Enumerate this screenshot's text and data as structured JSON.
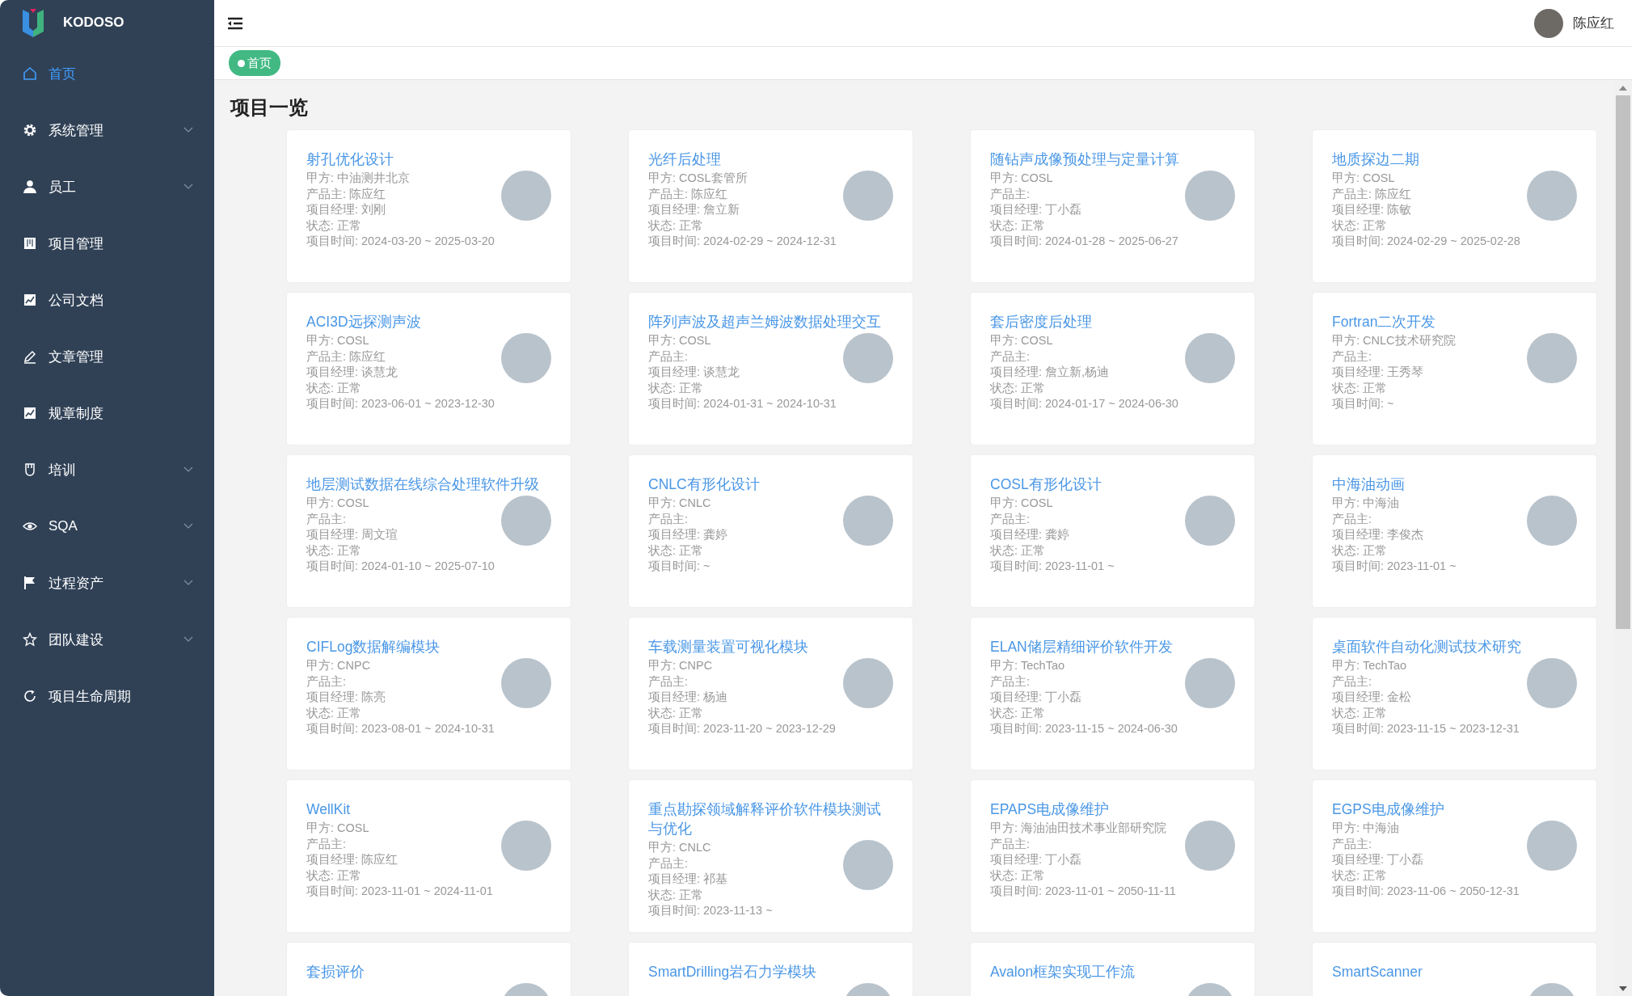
{
  "brand": {
    "name": "KODOSO"
  },
  "sidebar": {
    "items": [
      {
        "label": "首页",
        "selected": true,
        "has_submenu": false
      },
      {
        "label": "系统管理",
        "selected": false,
        "has_submenu": true
      },
      {
        "label": "员工",
        "selected": false,
        "has_submenu": true
      },
      {
        "label": "项目管理",
        "selected": false,
        "has_submenu": false
      },
      {
        "label": "公司文档",
        "selected": false,
        "has_submenu": false
      },
      {
        "label": "文章管理",
        "selected": false,
        "has_submenu": false
      },
      {
        "label": "规章制度",
        "selected": false,
        "has_submenu": false
      },
      {
        "label": "培训",
        "selected": false,
        "has_submenu": true
      },
      {
        "label": "SQA",
        "selected": false,
        "has_submenu": true
      },
      {
        "label": "过程资产",
        "selected": false,
        "has_submenu": true
      },
      {
        "label": "团队建设",
        "selected": false,
        "has_submenu": true
      },
      {
        "label": "项目生命周期",
        "selected": false,
        "has_submenu": false
      }
    ]
  },
  "header": {
    "user_name": "陈应红"
  },
  "tags": [
    {
      "label": "首页",
      "selected": true
    }
  ],
  "page_title": "项目一览",
  "projects": [
    {
      "title": "射孔优化设计",
      "lines": [
        "甲方: 中油测井北京",
        "产品主: 陈应红",
        "项目经理: 刘刚",
        "状态: 正常",
        "项目时间: 2024-03-20 ~ 2025-03-20"
      ]
    },
    {
      "title": "光纤后处理",
      "lines": [
        "甲方: COSL套管所",
        "产品主: 陈应红",
        "项目经理: 詹立新",
        "状态: 正常",
        "项目时间: 2024-02-29 ~ 2024-12-31"
      ]
    },
    {
      "title": "随钻声成像预处理与定量计算",
      "lines": [
        "甲方: COSL",
        "产品主:",
        "项目经理: 丁小磊",
        "状态: 正常",
        "项目时间: 2024-01-28 ~ 2025-06-27"
      ]
    },
    {
      "title": "地质探边二期",
      "lines": [
        "甲方: COSL",
        "产品主: 陈应红",
        "项目经理: 陈敏",
        "状态: 正常",
        "项目时间: 2024-02-29 ~ 2025-02-28"
      ]
    },
    {
      "title": "ACI3D远探测声波",
      "lines": [
        "甲方: COSL",
        "产品主: 陈应红",
        "项目经理: 谈慧龙",
        "状态: 正常",
        "项目时间: 2023-06-01 ~ 2023-12-30"
      ]
    },
    {
      "title": "阵列声波及超声兰姆波数据处理交互",
      "lines": [
        "甲方: COSL",
        "产品主:",
        "项目经理: 谈慧龙",
        "状态: 正常",
        "项目时间: 2024-01-31 ~ 2024-10-31"
      ]
    },
    {
      "title": "套后密度后处理",
      "lines": [
        "甲方: COSL",
        "产品主:",
        "项目经理: 詹立新,杨迪",
        "状态: 正常",
        "项目时间: 2024-01-17 ~ 2024-06-30"
      ]
    },
    {
      "title": "Fortran二次开发",
      "lines": [
        "甲方: CNLC技术研究院",
        "产品主:",
        "项目经理: 王秀琴",
        "状态: 正常",
        "项目时间: ~"
      ]
    },
    {
      "title": "地层测试数据在线综合处理软件升级",
      "lines": [
        "甲方: COSL",
        "产品主:",
        "项目经理: 周文瑄",
        "状态: 正常",
        "项目时间: 2024-01-10 ~ 2025-07-10"
      ]
    },
    {
      "title": "CNLC有形化设计",
      "lines": [
        "甲方: CNLC",
        "产品主:",
        "项目经理: 龚婷",
        "状态: 正常",
        "项目时间: ~"
      ]
    },
    {
      "title": "COSL有形化设计",
      "lines": [
        "甲方: COSL",
        "产品主:",
        "项目经理: 龚婷",
        "状态: 正常",
        "项目时间: 2023-11-01 ~"
      ]
    },
    {
      "title": "中海油动画",
      "lines": [
        "甲方: 中海油",
        "产品主:",
        "项目经理: 李俊杰",
        "状态: 正常",
        "项目时间: 2023-11-01 ~"
      ]
    },
    {
      "title": "CIFLog数据解编模块",
      "lines": [
        "甲方: CNPC",
        "产品主:",
        "项目经理: 陈亮",
        "状态: 正常",
        "项目时间: 2023-08-01 ~ 2024-10-31"
      ]
    },
    {
      "title": "车载测量装置可视化模块",
      "lines": [
        "甲方: CNPC",
        "产品主:",
        "项目经理: 杨迪",
        "状态: 正常",
        "项目时间: 2023-11-20 ~ 2023-12-29"
      ]
    },
    {
      "title": "ELAN储层精细评价软件开发",
      "lines": [
        "甲方: TechTao",
        "产品主:",
        "项目经理: 丁小磊",
        "状态: 正常",
        "项目时间: 2023-11-15 ~ 2024-06-30"
      ]
    },
    {
      "title": "桌面软件自动化测试技术研究",
      "lines": [
        "甲方: TechTao",
        "产品主:",
        "项目经理: 金松",
        "状态: 正常",
        "项目时间: 2023-11-15 ~ 2023-12-31"
      ]
    },
    {
      "title": "WellKit",
      "lines": [
        "甲方: COSL",
        "产品主:",
        "项目经理: 陈应红",
        "状态: 正常",
        "项目时间: 2023-11-01 ~ 2024-11-01"
      ]
    },
    {
      "title": "重点勘探领域解释评价软件模块测试与优化",
      "lines": [
        "甲方: CNLC",
        "产品主:",
        "项目经理: 祁基",
        "状态: 正常",
        "项目时间: 2023-11-13 ~"
      ]
    },
    {
      "title": "EPAPS电成像维护",
      "lines": [
        "甲方: 海油油田技术事业部研究院",
        "产品主:",
        "项目经理: 丁小磊",
        "状态: 正常",
        "项目时间: 2023-11-01 ~ 2050-11-11"
      ]
    },
    {
      "title": "EGPS电成像维护",
      "lines": [
        "甲方: 中海油",
        "产品主:",
        "项目经理: 丁小磊",
        "状态: 正常",
        "项目时间: 2023-11-06 ~ 2050-12-31"
      ]
    },
    {
      "title": "套损评价"
    },
    {
      "title": "SmartDrilling岩石力学模块"
    },
    {
      "title": "Avalon框架实现工作流"
    },
    {
      "title": "SmartScanner"
    }
  ]
}
